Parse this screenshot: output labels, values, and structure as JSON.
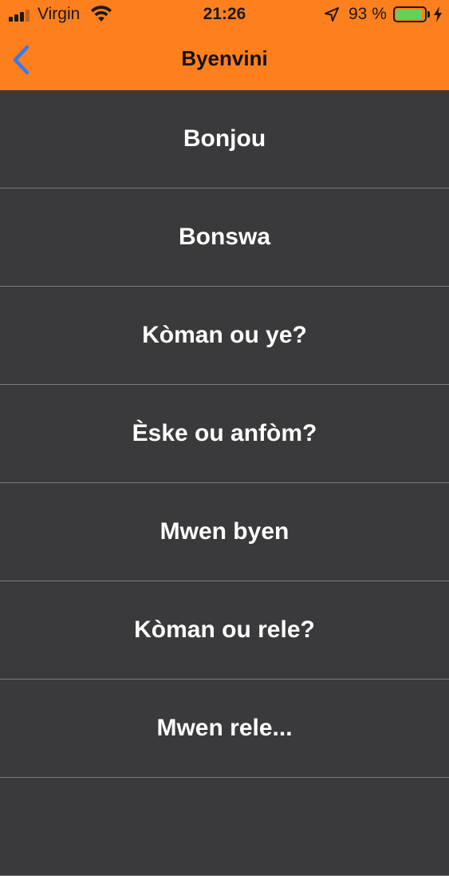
{
  "status_bar": {
    "carrier": "Virgin",
    "time": "21:26",
    "battery_percent": "93 %",
    "battery_level": 0.93,
    "icons": [
      "signal-icon",
      "wifi-icon",
      "location-icon",
      "battery-icon",
      "charging-bolt-icon"
    ],
    "colors": {
      "battery_fill": "#5fd35a"
    }
  },
  "nav": {
    "title": "Byenvini",
    "back_icon": "chevron-left-icon"
  },
  "colors": {
    "header": "#fd7f1e",
    "background": "#3a393b",
    "back_icon": "#2f7cf6",
    "row_text": "#ffffff"
  },
  "phrases": [
    {
      "label": "Bonjou"
    },
    {
      "label": "Bonswa"
    },
    {
      "label": "Kòman ou ye?"
    },
    {
      "label": "Èske ou anfòm?"
    },
    {
      "label": "Mwen byen"
    },
    {
      "label": "Kòman ou rele?"
    },
    {
      "label": "Mwen rele..."
    }
  ]
}
